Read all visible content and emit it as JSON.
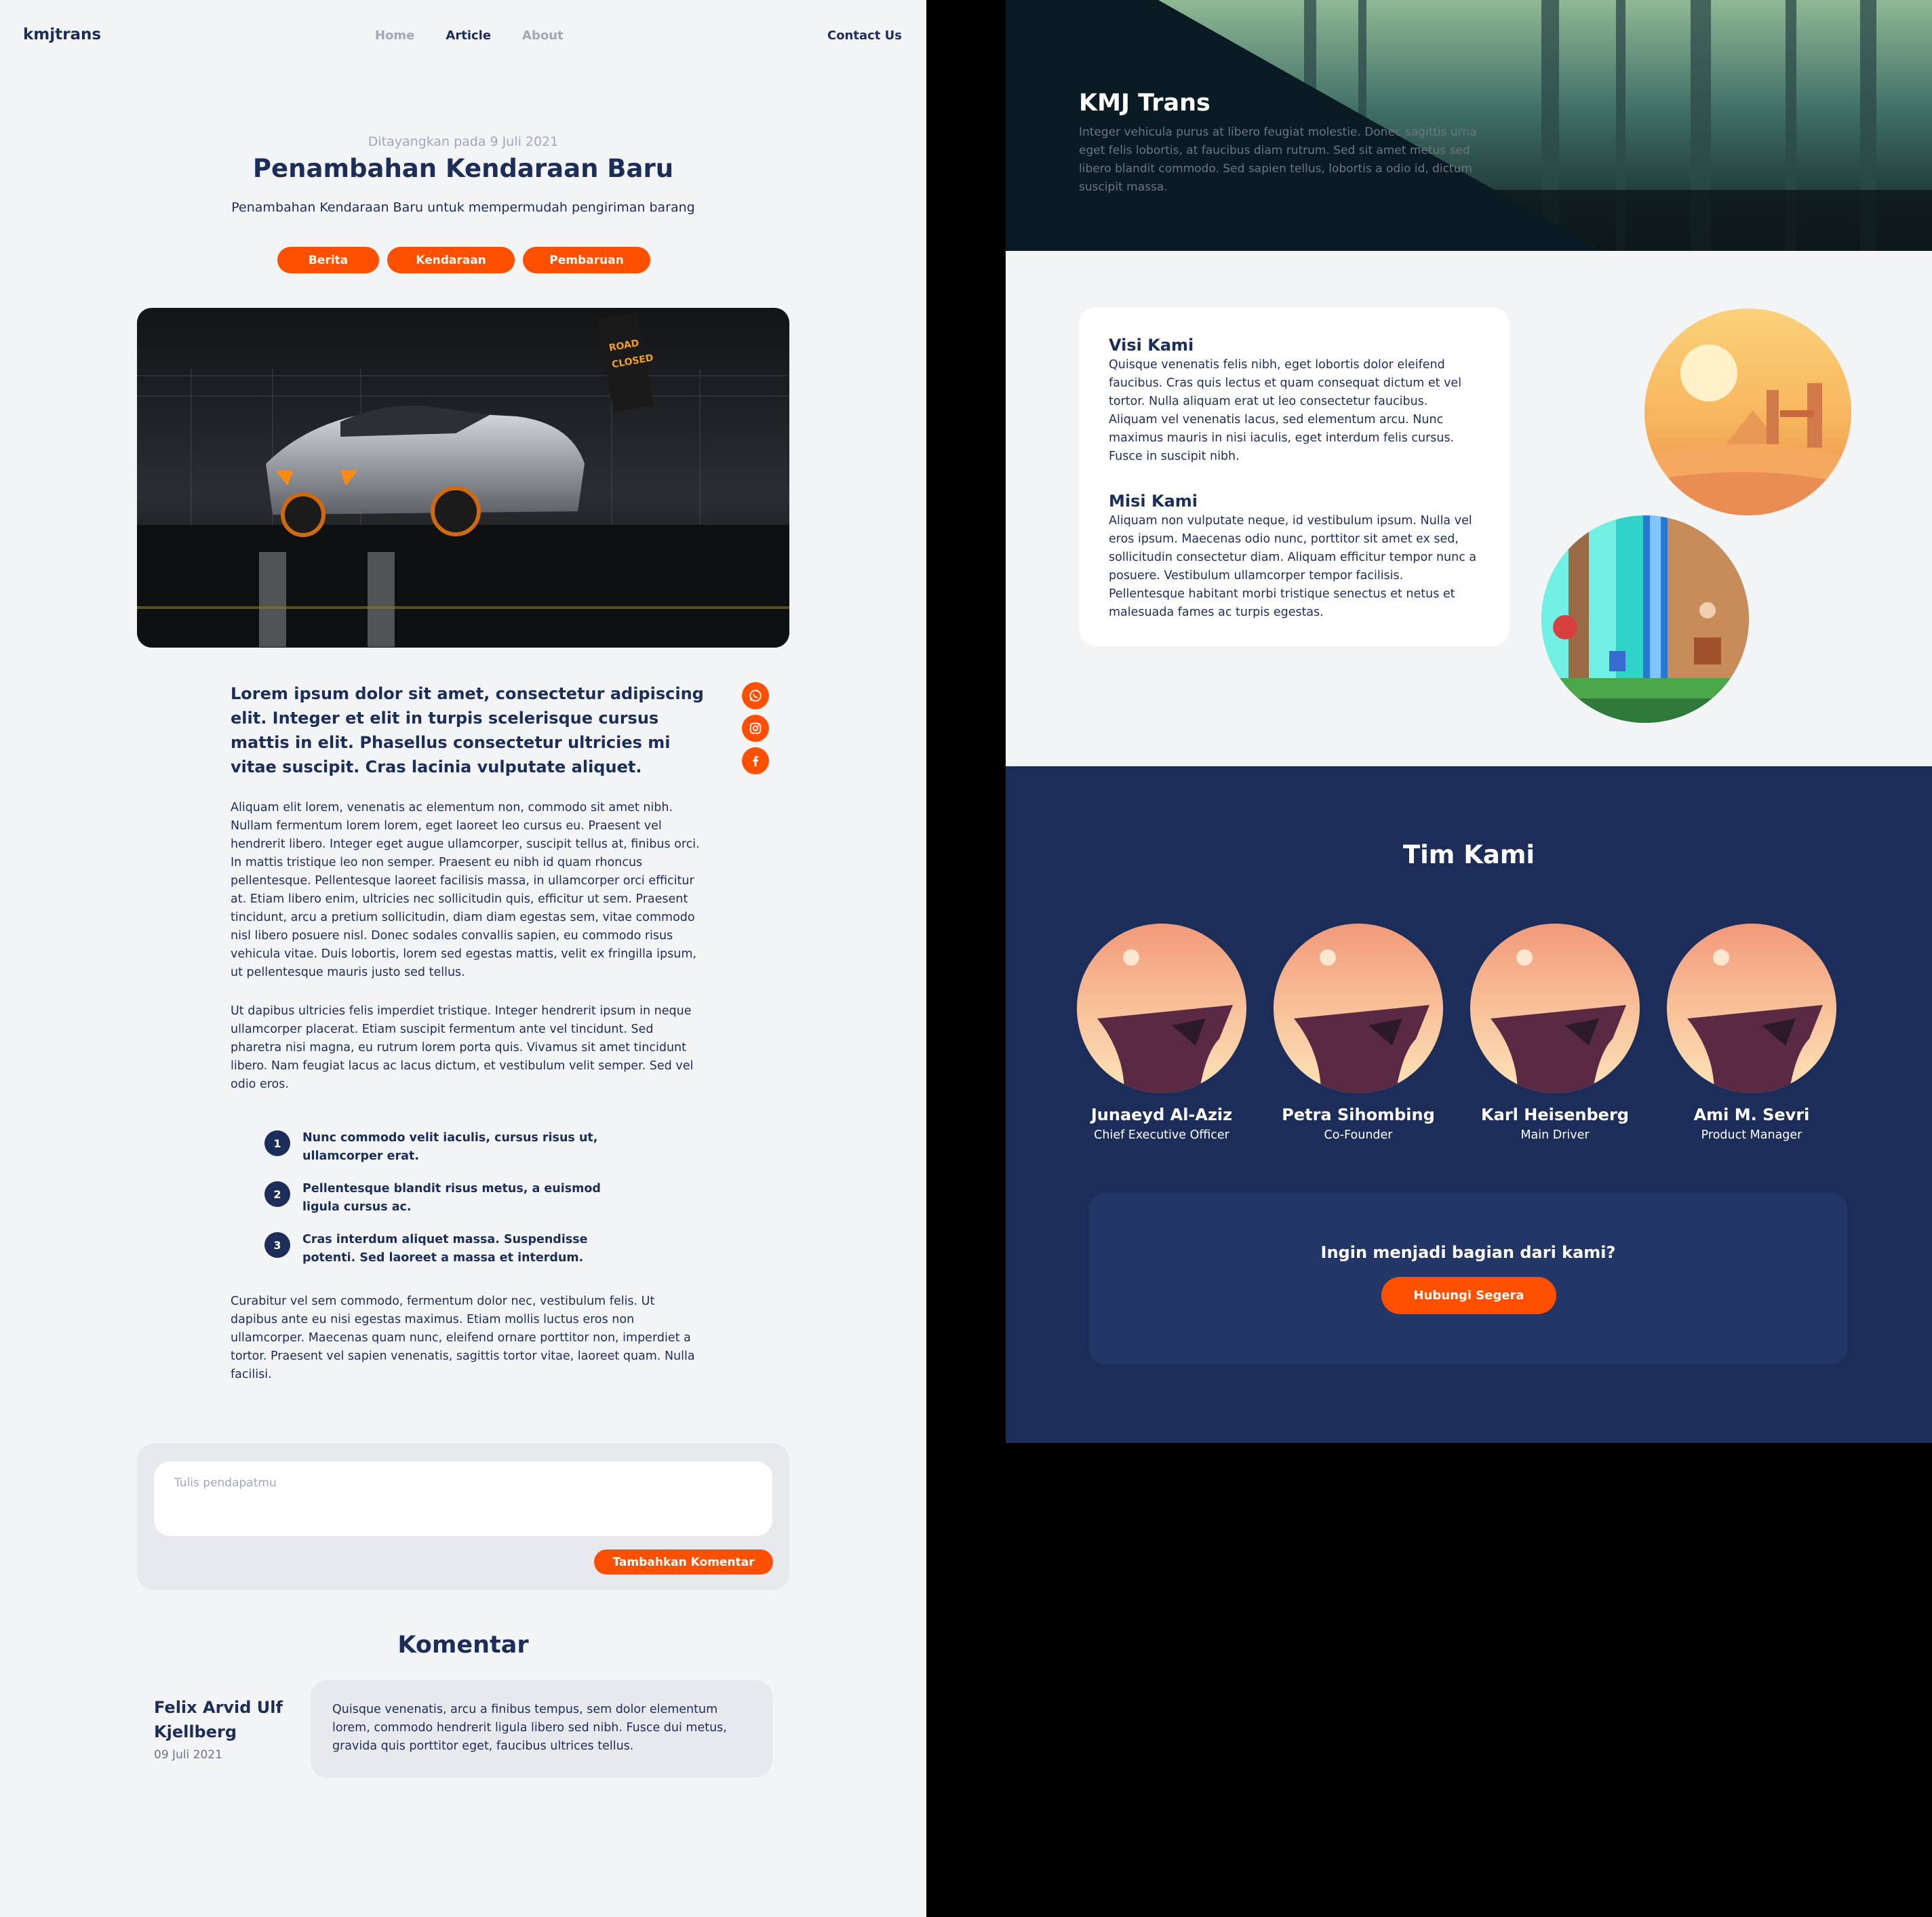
{
  "colors": {
    "navy": "#1c2d5a",
    "accent": "#ff5000",
    "bg": "#f3f4f6",
    "muted": "#a0a7b6"
  },
  "nav": {
    "logo": "kmjtrans",
    "links": [
      "Home",
      "Article",
      "About"
    ],
    "active": "Article",
    "contact": "Contact Us"
  },
  "article": {
    "posted": "Ditayangkan pada 9 Juli 2021",
    "title": "Penambahan Kendaraan Baru",
    "subtitle": "Penambahan Kendaraan Baru untuk mempermudah pengiriman barang",
    "tags": [
      "Berita",
      "Kendaraan",
      "Pembaruan"
    ],
    "hero_image": "car-photo",
    "share_icons": [
      "whatsapp-icon",
      "instagram-icon",
      "facebook-icon"
    ],
    "lead": "Lorem ipsum dolor sit amet, consectetur adipiscing elit. Integer et elit in turpis scelerisque cursus mattis in elit. Phasellus consectetur ultricies mi vitae suscipit. Cras lacinia vulputate aliquet.",
    "p1": "Aliquam elit lorem, venenatis ac elementum non, commodo sit amet nibh. Nullam fermentum lorem lorem, eget laoreet leo cursus eu. Praesent vel hendrerit libero. Integer eget augue ullamcorper, suscipit tellus at, finibus orci. In mattis tristique leo non semper. Praesent eu nibh id quam rhoncus pellentesque. Pellentesque laoreet facilisis massa, in ullamcorper orci efficitur at. Etiam libero enim, ultricies nec sollicitudin quis, efficitur ut sem. Praesent tincidunt, arcu a pretium sollicitudin, diam diam egestas sem, vitae commodo nisl libero posuere nisl. Donec sodales convallis sapien, eu commodo risus vehicula vitae. Duis lobortis, lorem sed egestas mattis, velit ex fringilla ipsum, ut pellentesque mauris justo sed tellus.",
    "p2": "Ut dapibus ultricies felis imperdiet tristique. Integer hendrerit ipsum in neque ullamcorper placerat. Etiam suscipit fermentum ante vel tincidunt. Sed pharetra nisi magna, eu rutrum lorem porta quis. Vivamus sit amet tincidunt libero. Nam feugiat lacus ac lacus dictum, et vestibulum velit semper. Sed vel odio eros.",
    "list": [
      {
        "num": "1",
        "text": "Nunc commodo velit iaculis, cursus risus ut, ullamcorper erat."
      },
      {
        "num": "2",
        "text": "Pellentesque blandit risus metus, a euismod ligula cursus ac."
      },
      {
        "num": "3",
        "text": "Cras interdum aliquet massa. Suspendisse potenti. Sed laoreet a massa et interdum."
      }
    ],
    "p3": "Curabitur vel sem commodo, fermentum dolor nec, vestibulum felis. Ut dapibus ante eu nisi egestas maximus. Etiam mollis luctus eros non ullamcorper. Maecenas quam nunc, eleifend ornare porttitor non, imperdiet a tortor. Praesent vel sapien venenatis, sagittis tortor vitae, laoreet quam. Nulla facilisi."
  },
  "comment_form": {
    "placeholder": "Tulis pendapatmu",
    "value": "",
    "button": "Tambahkan Komentar"
  },
  "comments": {
    "heading": "Komentar",
    "items": [
      {
        "author": "Felix Arvid Ulf Kjellberg",
        "date": "09 Juli 2021",
        "text": "Quisque venenatis, arcu a finibus tempus, sem dolor elementum lorem, commodo hendrerit ligula libero sed nibh. Fusce dui metus, gravida quis porttitor eget, faucibus ultrices tellus."
      }
    ]
  },
  "about": {
    "hero_title": "KMJ Trans",
    "hero_text": "Integer vehicula purus at libero feugiat molestie. Donec sagittis urna eget felis lobortis, at faucibus diam rutrum. Sed sit amet metus sed libero blandit commodo. Sed sapien tellus, lobortis a odio id, dictum suscipit massa.",
    "visi_title": "Visi Kami",
    "visi_text": "Quisque venenatis felis nibh, eget lobortis dolor eleifend faucibus. Cras quis lectus et quam consequat dictum et vel tortor. Nulla aliquam erat ut leo consectetur faucibus. Aliquam vel venenatis lacus, sed elementum arcu. Nunc maximus mauris in nisi iaculis, eget interdum felis cursus. Fusce in suscipit nibh.",
    "misi_title": "Misi Kami",
    "misi_text": "Aliquam non vulputate neque, id vestibulum ipsum. Nulla vel eros ipsum. Maecenas odio nunc, porttitor sit amet ex sed, sollicitudin consectetur diam. Aliquam efficitur tempor nunc a posuere. Vestibulum ullamcorper tempor facilisis. Pellentesque habitant morbi tristique senectus et netus et malesuada fames ac turpis egestas.",
    "team_heading": "Tim Kami",
    "team": [
      {
        "name": "Junaeyd Al-Aziz",
        "role": "Chief Executive Officer"
      },
      {
        "name": "Petra Sihombing",
        "role": "Co-Founder"
      },
      {
        "name": "Karl Heisenberg",
        "role": "Main Driver"
      },
      {
        "name": "Ami M. Sevri",
        "role": "Product Manager"
      }
    ],
    "join_question": "Ingin menjadi bagian dari kami?",
    "join_button": "Hubungi Segera"
  }
}
